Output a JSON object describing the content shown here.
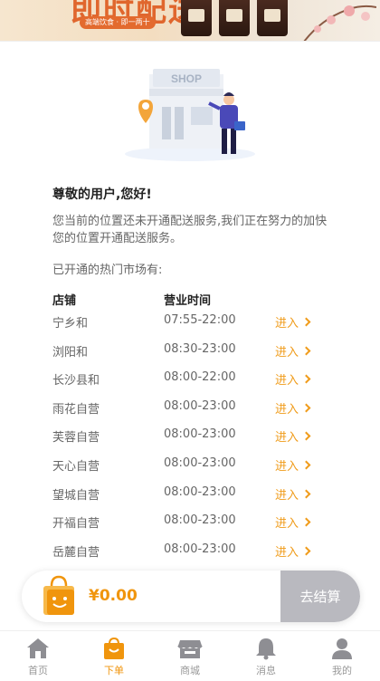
{
  "banner": {
    "title": "即时配送",
    "tag": "高端饮食 · 即一两十"
  },
  "greeting": "尊敬的用户,您好!",
  "notice": "您当前的位置还未开通配送服务,我们正在努力的加快您的位置开通配送服务。",
  "markets_title": "已开通的热门市场有:",
  "table": {
    "col_store": "店铺",
    "col_hours": "营业时间",
    "enter_label": "进入",
    "rows": [
      {
        "store": "宁乡和",
        "hours": "07:55-22:00"
      },
      {
        "store": "浏阳和",
        "hours": "08:30-23:00"
      },
      {
        "store": "长沙县和",
        "hours": "08:00-22:00"
      },
      {
        "store": "雨花自营",
        "hours": "08:00-23:00"
      },
      {
        "store": "芙蓉自营",
        "hours": "08:00-23:00"
      },
      {
        "store": "天心自营",
        "hours": "08:00-23:00"
      },
      {
        "store": "望城自营",
        "hours": "08:00-23:00"
      },
      {
        "store": "开福自营",
        "hours": "08:00-23:00"
      },
      {
        "store": "岳麓自营",
        "hours": "08:00-23:00"
      }
    ]
  },
  "illustration": {
    "sign": "SHOP"
  },
  "cart": {
    "price": "¥0.00",
    "checkout_label": "去结算"
  },
  "tabbar": {
    "items": [
      {
        "label": "首页",
        "icon": "home-icon",
        "active": false
      },
      {
        "label": "下单",
        "icon": "bag-icon",
        "active": true
      },
      {
        "label": "商城",
        "icon": "store-icon",
        "active": false
      },
      {
        "label": "消息",
        "icon": "bell-icon",
        "active": false
      },
      {
        "label": "我的",
        "icon": "user-icon",
        "active": false
      }
    ]
  },
  "colors": {
    "accent": "#f0950d",
    "checkout_disabled": "#b9b9bf"
  }
}
